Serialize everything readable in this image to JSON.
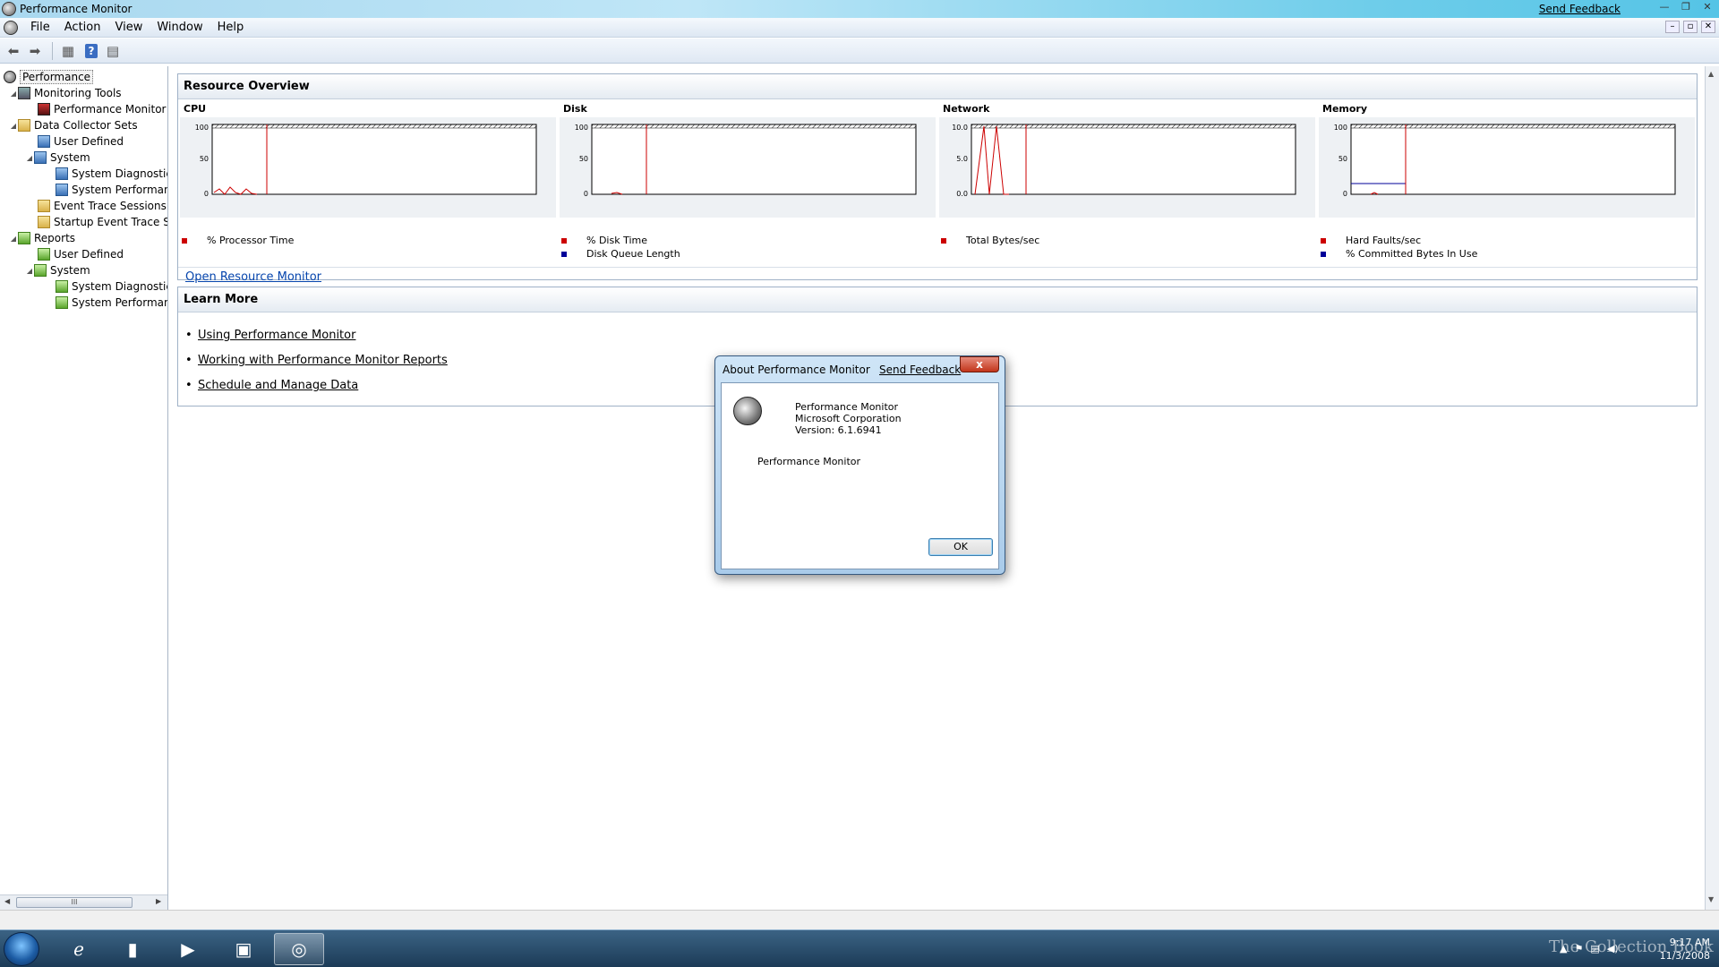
{
  "window": {
    "title": "Performance Monitor",
    "send_feedback": "Send Feedback",
    "controls": [
      "—",
      "❐",
      "✕"
    ]
  },
  "menubar": {
    "items": [
      "File",
      "Action",
      "View",
      "Window",
      "Help"
    ]
  },
  "mdi_controls": [
    "–",
    "▫",
    "✕"
  ],
  "tree": {
    "items": [
      {
        "label": "Performance",
        "icon": "performance-icon"
      },
      {
        "label": "Monitoring Tools",
        "icon": "tools-icon"
      },
      {
        "label": "Performance Monitor",
        "icon": "monitor-icon"
      },
      {
        "label": "Data Collector Sets",
        "icon": "folder-icon"
      },
      {
        "label": "User Defined",
        "icon": "dcset-icon"
      },
      {
        "label": "System",
        "icon": "dcset-icon"
      },
      {
        "label": "System Diagnostics",
        "icon": "dcset-icon"
      },
      {
        "label": "System Performanc",
        "icon": "dcset-icon"
      },
      {
        "label": "Event Trace Sessions",
        "icon": "folder-icon"
      },
      {
        "label": "Startup Event Trace Ses",
        "icon": "folder-icon"
      },
      {
        "label": "Reports",
        "icon": "report-icon"
      },
      {
        "label": "User Defined",
        "icon": "report-icon"
      },
      {
        "label": "System",
        "icon": "report-icon"
      },
      {
        "label": "System Diagnostics",
        "icon": "report-icon"
      },
      {
        "label": "System Performanc",
        "icon": "report-icon"
      }
    ],
    "scroll_thumb": "III"
  },
  "resource_overview": {
    "title": "Resource Overview",
    "charts": [
      {
        "title": "CPU",
        "yticks": [
          "100",
          "50",
          "0"
        ],
        "legend": [
          "% Processor Time"
        ]
      },
      {
        "title": "Disk",
        "yticks": [
          "100",
          "50",
          "0"
        ],
        "legend": [
          "% Disk Time",
          "Disk Queue Length"
        ]
      },
      {
        "title": "Network",
        "yticks": [
          "10.0",
          "5.0",
          "0.0"
        ],
        "legend": [
          "Total Bytes/sec"
        ]
      },
      {
        "title": "Memory",
        "yticks": [
          "100",
          "50",
          "0"
        ],
        "legend": [
          "Hard Faults/sec",
          "% Committed Bytes In Use"
        ]
      }
    ],
    "open_link": "Open Resource Monitor"
  },
  "learn_more": {
    "title": "Learn More",
    "links": [
      "Using Performance Monitor",
      "Working with Performance Monitor Reports",
      "Schedule and Manage Data"
    ]
  },
  "about_dialog": {
    "title": "About Performance Monitor",
    "send_feedback": "Send Feedback",
    "close": "x",
    "product": "Performance Monitor",
    "company": "Microsoft Corporation",
    "version": "Version: 6.1.6941",
    "description": "Performance Monitor",
    "ok": "OK"
  },
  "taskbar": {
    "time": "9:17 AM",
    "date": "11/3/2008",
    "watermark": "The Collection Book"
  },
  "colors": {
    "series_red": "#cc0000",
    "series_blue": "#000099",
    "link": "#0645ad"
  }
}
